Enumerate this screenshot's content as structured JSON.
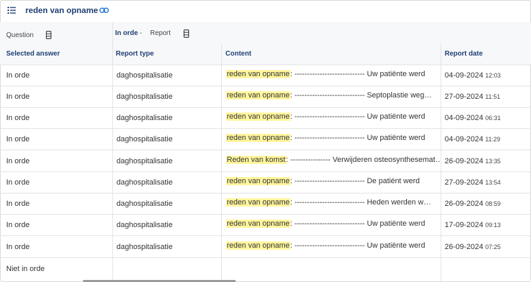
{
  "header": {
    "title": "reden van opname",
    "menu_icon": "hamburger-list-icon",
    "link_icon": "link-icon"
  },
  "filters": {
    "question_label": "Question",
    "answer_filter": "In orde",
    "separator": "-",
    "report_label": "Report"
  },
  "columns": {
    "selected_answer": "Selected answer",
    "report_type": "Report type",
    "content": "Content",
    "report_date": "Report date"
  },
  "colors": {
    "accent": "#1f3f73",
    "highlight": "#fff59d",
    "link": "#2a7ad6"
  },
  "rows": [
    {
      "answer": "In orde",
      "type": "daghospitalisatie",
      "highlight": "reden van opname",
      "rest": ": ---------------------------- Uw patiënte werd",
      "date": "04-09-2024",
      "time": "12:03"
    },
    {
      "answer": "In orde",
      "type": "daghospitalisatie",
      "highlight": "reden van opname",
      "rest": ": ---------------------------- Septoplastie weg…",
      "date": "27-09-2024",
      "time": "11:51"
    },
    {
      "answer": "In orde",
      "type": "daghospitalisatie",
      "highlight": "reden van opname",
      "rest": ": ---------------------------- Uw patiënte werd",
      "date": "04-09-2024",
      "time": "06:31"
    },
    {
      "answer": "In orde",
      "type": "daghospitalisatie",
      "highlight": "reden van opname",
      "rest": ": ---------------------------- Uw patiënte werd",
      "date": "04-09-2024",
      "time": "11:29"
    },
    {
      "answer": "In orde",
      "type": "daghospitalisatie",
      "highlight": "Reden van komst",
      "rest": ": ---------------- Verwijderen osteosynthesemat…",
      "date": "26-09-2024",
      "time": "13:35"
    },
    {
      "answer": "In orde",
      "type": "daghospitalisatie",
      "highlight": "reden van opname",
      "rest": ": ---------------------------- De patiënt werd",
      "date": "27-09-2024",
      "time": "13:54"
    },
    {
      "answer": "In orde",
      "type": "daghospitalisatie",
      "highlight": "reden van opname",
      "rest": ": ---------------------------- Heden werden w…",
      "date": "26-09-2024",
      "time": "08:59"
    },
    {
      "answer": "In orde",
      "type": "daghospitalisatie",
      "highlight": "reden van opname",
      "rest": ": ---------------------------- Uw patiënte werd",
      "date": "17-09-2024",
      "time": "09:13"
    },
    {
      "answer": "In orde",
      "type": "daghospitalisatie",
      "highlight": "reden van opname",
      "rest": ": ---------------------------- Uw patiënte werd",
      "date": "26-09-2024",
      "time": "07:25"
    },
    {
      "answer": "Niet in orde",
      "type": "",
      "highlight": "",
      "rest": "",
      "date": "",
      "time": ""
    }
  ]
}
